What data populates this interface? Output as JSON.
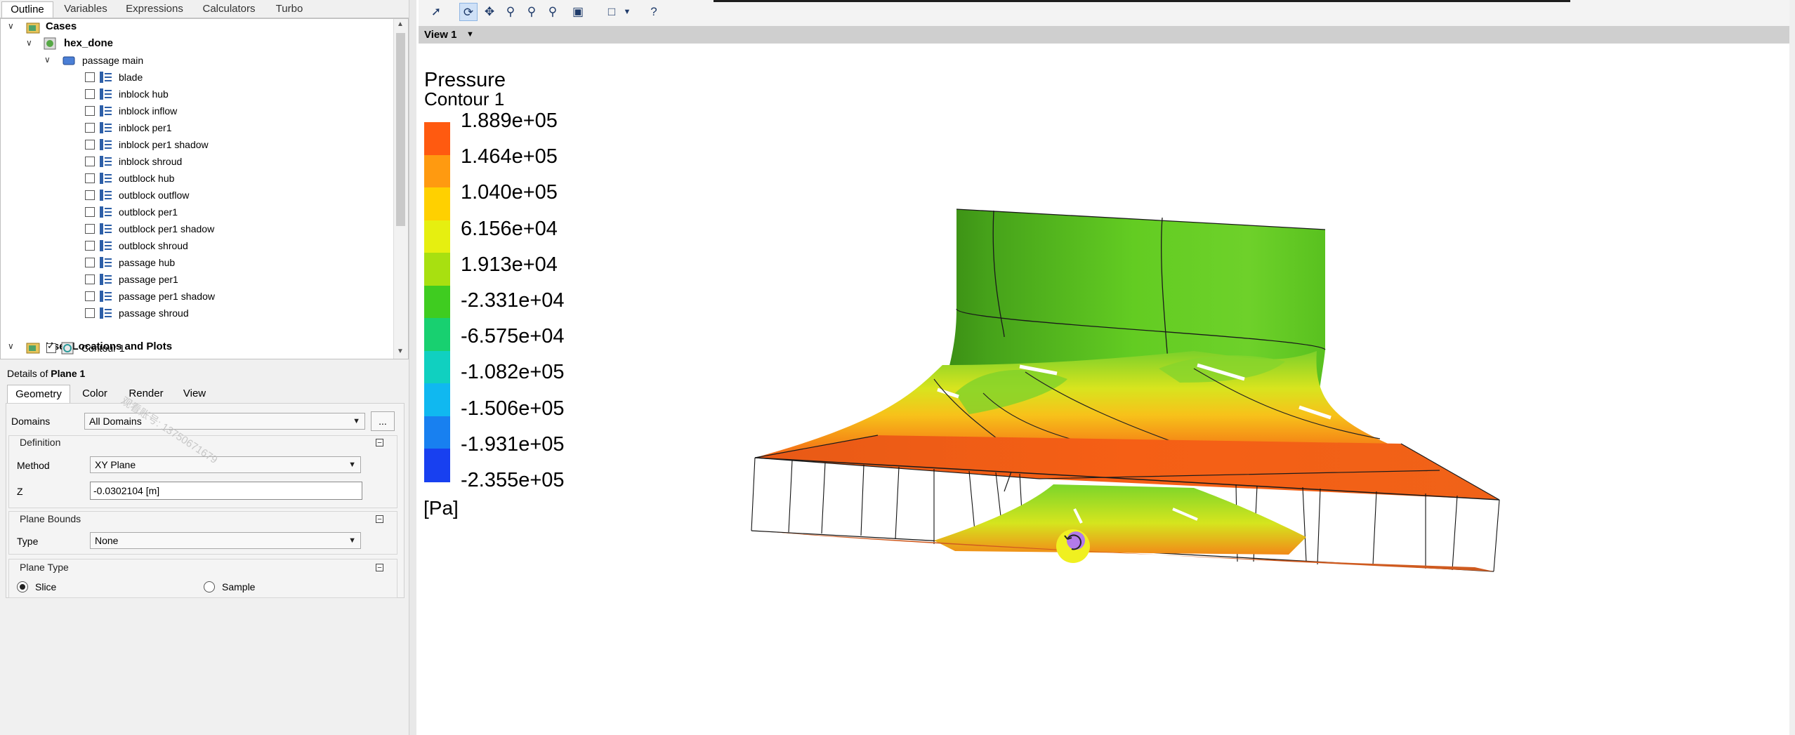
{
  "tabs": [
    "Outline",
    "Variables",
    "Expressions",
    "Calculators",
    "Turbo"
  ],
  "tree": {
    "cases_label": "Cases",
    "case_name": "hex_done",
    "domain_name": "passage main",
    "regions": [
      "blade",
      "inblock hub",
      "inblock inflow",
      "inblock per1",
      "inblock per1 shadow",
      "inblock shroud",
      "outblock hub",
      "outblock outflow",
      "outblock per1",
      "outblock per1 shadow",
      "outblock shroud",
      "passage hub",
      "passage per1",
      "passage per1 shadow",
      "passage shroud"
    ],
    "user_locations_label": "User Locations and Plots",
    "contour_label": "Contour 1"
  },
  "details": {
    "title_prefix": "Details of ",
    "title_object": "Plane 1",
    "tabs": [
      "Geometry",
      "Color",
      "Render",
      "View"
    ],
    "domains_label": "Domains",
    "domains_value": "All Domains",
    "ellipsis": "...",
    "definition_label": "Definition",
    "method_label": "Method",
    "method_value": "XY Plane",
    "z_label": "Z",
    "z_value": "-0.0302104 [m]",
    "plane_bounds_label": "Plane Bounds",
    "type_label": "Type",
    "type_value": "None",
    "plane_type_label": "Plane Type",
    "slice_label": "Slice",
    "sample_label": "Sample",
    "watermark": "观看账号: 13750671679"
  },
  "viewport": {
    "view_label": "View 1",
    "legend_title": "Pressure",
    "legend_subtitle": "Contour 1",
    "legend_ticks": [
      "1.889e+05",
      "1.464e+05",
      "1.040e+05",
      "6.156e+04",
      "1.913e+04",
      "-2.331e+04",
      "-6.575e+04",
      "-1.082e+05",
      "-1.506e+05",
      "-1.931e+05",
      "-2.355e+05"
    ],
    "legend_colors": [
      "#ff5a10",
      "#ff9a10",
      "#ffd000",
      "#e6ef10",
      "#a8e010",
      "#3fcc20",
      "#18d070",
      "#10d0c0",
      "#10b8f0",
      "#1880f0",
      "#1840f0"
    ],
    "legend_unit": "[Pa]"
  },
  "colors": {
    "accent": "#cfe1f7",
    "field_green": "#5cc81e",
    "field_orange": "#f45a14",
    "field_yellow": "#f2d91a"
  }
}
